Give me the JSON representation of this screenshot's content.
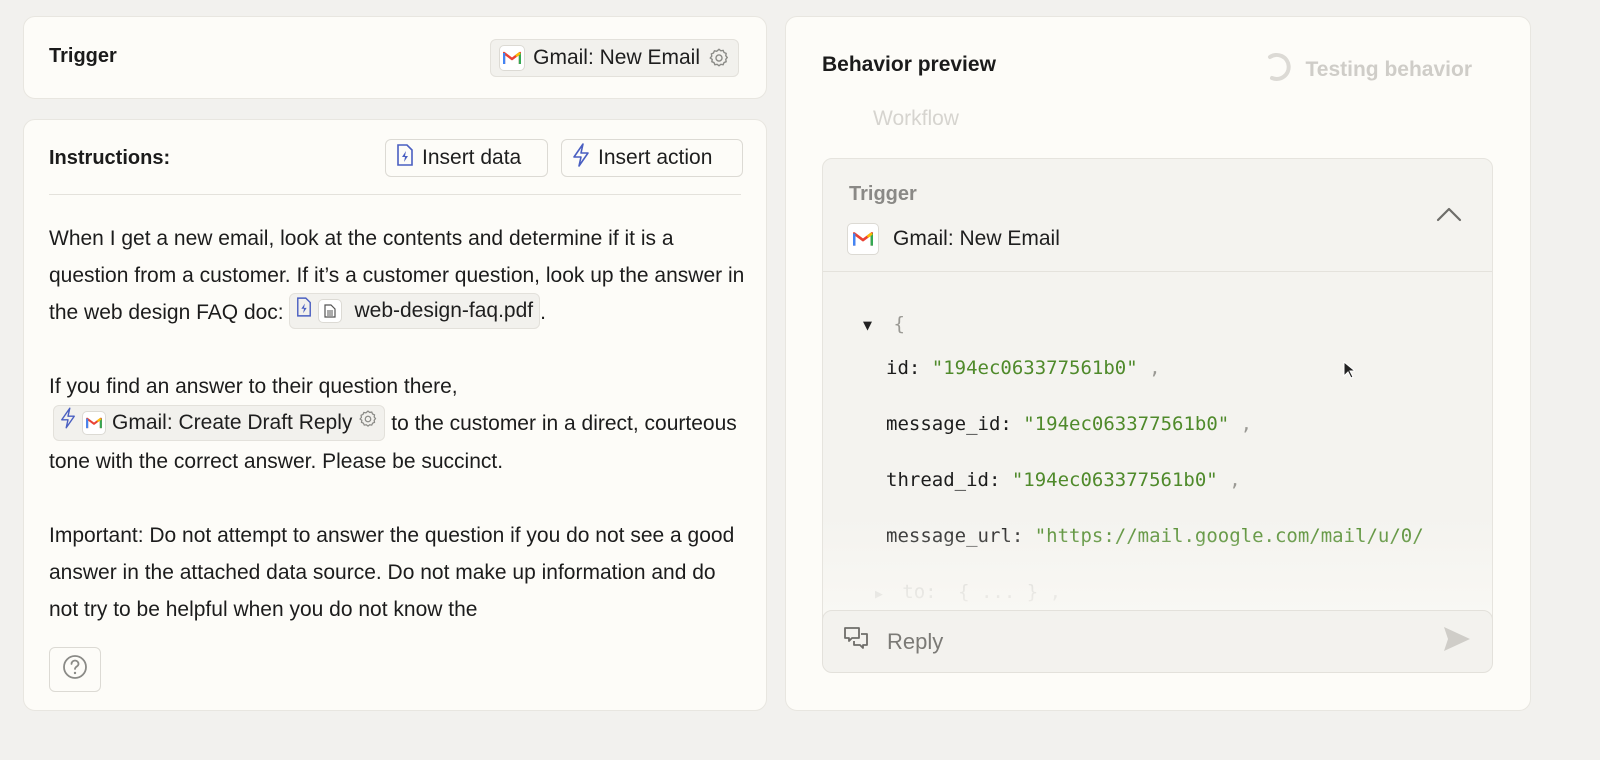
{
  "trigger_card": {
    "title": "Trigger",
    "app_chip": {
      "label": "Gmail: New Email",
      "icon": "gmail-icon",
      "settings_icon": "gear-icon"
    }
  },
  "instructions": {
    "title": "Instructions:",
    "insert_data_label": "Insert data",
    "insert_action_label": "Insert action",
    "paragraph1_text": "When I get a new email, look at the contents and determine if it is a question from a customer. If it’s a customer question, look up the answer in the web design FAQ doc:",
    "file_chip_label": "web-design-faq.pdf",
    "paragraph1_end": ".",
    "paragraph2_start": "If you find an answer to their question there,",
    "action_chip_label": "Gmail: Create Draft Reply",
    "paragraph2_end": "to the customer in a direct, courteous tone with the correct answer. Please be succinct.",
    "paragraph3_text": "Important: Do not attempt to answer the question if you do not see a good answer in the attached data source. Do not make up information and do not try to be helpful when you do not know the",
    "help_icon": "question-circle-icon"
  },
  "preview": {
    "title": "Behavior preview",
    "status": "Testing behavior",
    "ghost_text": "Workflow",
    "trigger_panel": {
      "label": "Trigger",
      "app_label": "Gmail: New Email",
      "json_open": "{",
      "fields": [
        {
          "key": "id:",
          "value": "\"194ec063377561b0\"",
          "sep": ","
        },
        {
          "key": "message_id:",
          "value": "\"194ec063377561b0\"",
          "sep": ","
        },
        {
          "key": "thread_id:",
          "value": "\"194ec063377561b0\"",
          "sep": ","
        },
        {
          "key": "message_url:",
          "value": "\"https://mail.google.com/mail/u/0/",
          "sep": ""
        }
      ],
      "collapsed_field": {
        "key": "to:",
        "value": "{ ... }",
        "sep": ","
      }
    },
    "reply": {
      "placeholder": "Reply"
    }
  },
  "colors": {
    "background": "#f2f1ee",
    "card": "#fdfcf8",
    "json_string": "#4f8a2b",
    "accent_icon": "#4a5fc1"
  }
}
